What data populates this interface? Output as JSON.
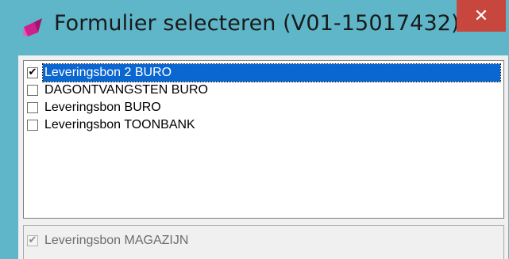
{
  "window": {
    "title": "Formulier selecteren (V01-15017432)",
    "close_glyph": "✕",
    "icon": "pink-brush-icon",
    "colors": {
      "titlebar": "#5fb6c8",
      "close": "#c7463d",
      "selection": "#0a66d1"
    }
  },
  "list": {
    "items": [
      {
        "label": "Leveringsbon 2 BURO",
        "checked": true,
        "selected": true,
        "check_glyph": "✔"
      },
      {
        "label": "DAGONTVANGSTEN BURO",
        "checked": false,
        "selected": false,
        "check_glyph": ""
      },
      {
        "label": "Leveringsbon BURO",
        "checked": false,
        "selected": false,
        "check_glyph": ""
      },
      {
        "label": "Leveringsbon TOONBANK",
        "checked": false,
        "selected": false,
        "check_glyph": ""
      }
    ]
  },
  "bottom": {
    "label": "Leveringsbon MAGAZIJN",
    "checked": true,
    "disabled": true,
    "check_glyph": "✔"
  }
}
